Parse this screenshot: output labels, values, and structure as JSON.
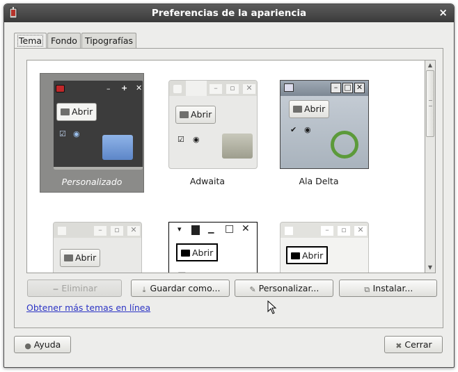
{
  "window": {
    "title": "Preferencias de la apariencia",
    "close_icon": "close-icon",
    "app_icon": "appearance-app-icon"
  },
  "tabs": [
    {
      "label": "Tema",
      "active": true
    },
    {
      "label": "Fondo",
      "active": false
    },
    {
      "label": "Tipografías",
      "active": false
    }
  ],
  "themes": [
    {
      "name": "Personalizado",
      "selected": true,
      "button": "Abrir"
    },
    {
      "name": "Adwaita",
      "selected": false,
      "button": "Abrir"
    },
    {
      "name": "Ala Delta",
      "selected": false,
      "button": "Abrir"
    },
    {
      "name": "",
      "selected": false,
      "button": "Abrir"
    },
    {
      "name": "",
      "selected": false,
      "button": "Abrir"
    },
    {
      "name": "",
      "selected": false,
      "button": "Abrir"
    }
  ],
  "actions": {
    "delete": "Eliminar",
    "save_as": "Guardar como...",
    "customize": "Personalizar...",
    "install": "Instalar..."
  },
  "link": "Obtener más temas en línea",
  "footer": {
    "help": "Ayuda",
    "close": "Cerrar"
  },
  "colors": {
    "selected_bg": "#8b8b89",
    "link": "#2b33c4",
    "titlebar": "#444444"
  }
}
